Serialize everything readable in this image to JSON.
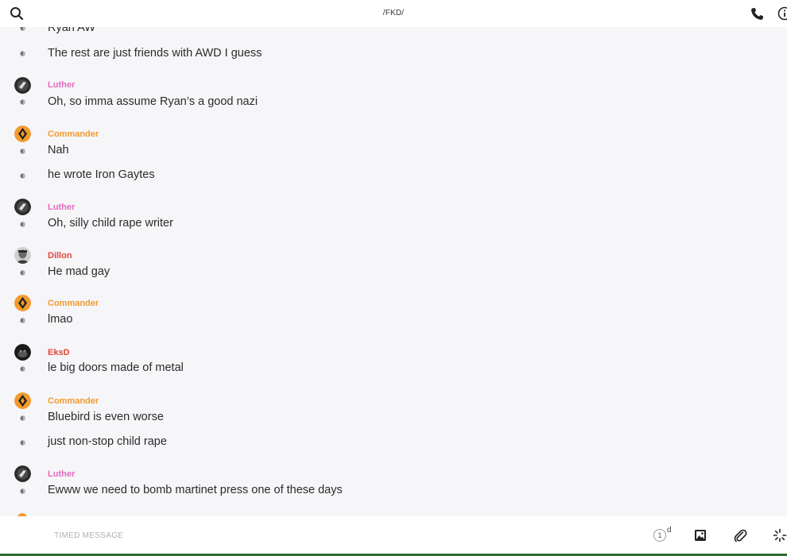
{
  "header": {
    "title": "/FKD/",
    "icons": [
      "search-icon",
      "phone-icon",
      "info-icon"
    ]
  },
  "messages": [
    {
      "sender": "",
      "text": "Ryan AW",
      "avatar": ""
    },
    {
      "sender": "",
      "text": "The rest are just friends with AWD I guess",
      "avatar": ""
    },
    {
      "sender": "Luther",
      "text": "Oh, so imma assume Ryan’s a good nazi",
      "avatar": "luther-avatar"
    },
    {
      "sender": "Commander",
      "text": "Nah",
      "avatar": "commander-avatar"
    },
    {
      "sender": "",
      "text": "he wrote Iron Gaytes",
      "avatar": ""
    },
    {
      "sender": "Luther",
      "text": "Oh, silly child rape writer",
      "avatar": "luther-avatar"
    },
    {
      "sender": "Dillon",
      "text": "He mad gay",
      "avatar": "dillon-avatar"
    },
    {
      "sender": "Commander",
      "text": "lmao",
      "avatar": "commander-avatar"
    },
    {
      "sender": "EksD",
      "text": "le big doors made of metal",
      "avatar": "eksd-avatar"
    },
    {
      "sender": "Commander",
      "text": "Bluebird is even worse",
      "avatar": "commander-avatar"
    },
    {
      "sender": "",
      "text": "just non-stop child rape",
      "avatar": ""
    },
    {
      "sender": "Luther",
      "text": "Ewww we need to bomb martinet press one of these days",
      "avatar": "luther-avatar"
    }
  ],
  "composer": {
    "placeholder": "TIMED MESSAGE",
    "timer_value": "1",
    "timer_unit": "d",
    "icons": [
      "timer-icon",
      "image-icon",
      "attachment-icon",
      "sparkle-icon"
    ]
  },
  "colors": {
    "luther": "#e36cbf",
    "commander": "#f29a2e",
    "dillon": "#e0473c",
    "eksd": "#e0473c",
    "background": "#f6f5f8",
    "bar": "#ffffff"
  }
}
